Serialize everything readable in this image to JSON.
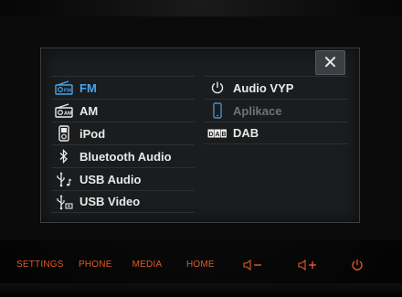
{
  "colors": {
    "accent": "#4aa3e8",
    "text": "#e9e9e9",
    "disabled": "#6f7378",
    "hardware_button": "#e05a2a",
    "panel_bg": "#1a1c1e"
  },
  "popup": {
    "close_label": "✕",
    "left_items": [
      {
        "label": "FM",
        "icon": "radio-fm-icon",
        "selected": true
      },
      {
        "label": "AM",
        "icon": "radio-am-icon"
      },
      {
        "label": "iPod",
        "icon": "ipod-icon"
      },
      {
        "label": "Bluetooth Audio",
        "icon": "bluetooth-icon"
      },
      {
        "label": "USB Audio",
        "icon": "usb-audio-icon"
      },
      {
        "label": "USB Video",
        "icon": "usb-video-icon"
      }
    ],
    "right_items": [
      {
        "label": "Audio VYP",
        "icon": "power-icon"
      },
      {
        "label": "Aplikace",
        "icon": "phone-app-icon",
        "disabled": true
      },
      {
        "label": "DAB",
        "icon": "dab-icon"
      }
    ]
  },
  "hardware_buttons": {
    "settings": "SETTINGS",
    "phone": "PHONE",
    "media": "MEDIA",
    "home": "HOME",
    "volume_down": "volume-down-icon",
    "volume_up": "volume-up-icon",
    "power": "power-icon"
  }
}
